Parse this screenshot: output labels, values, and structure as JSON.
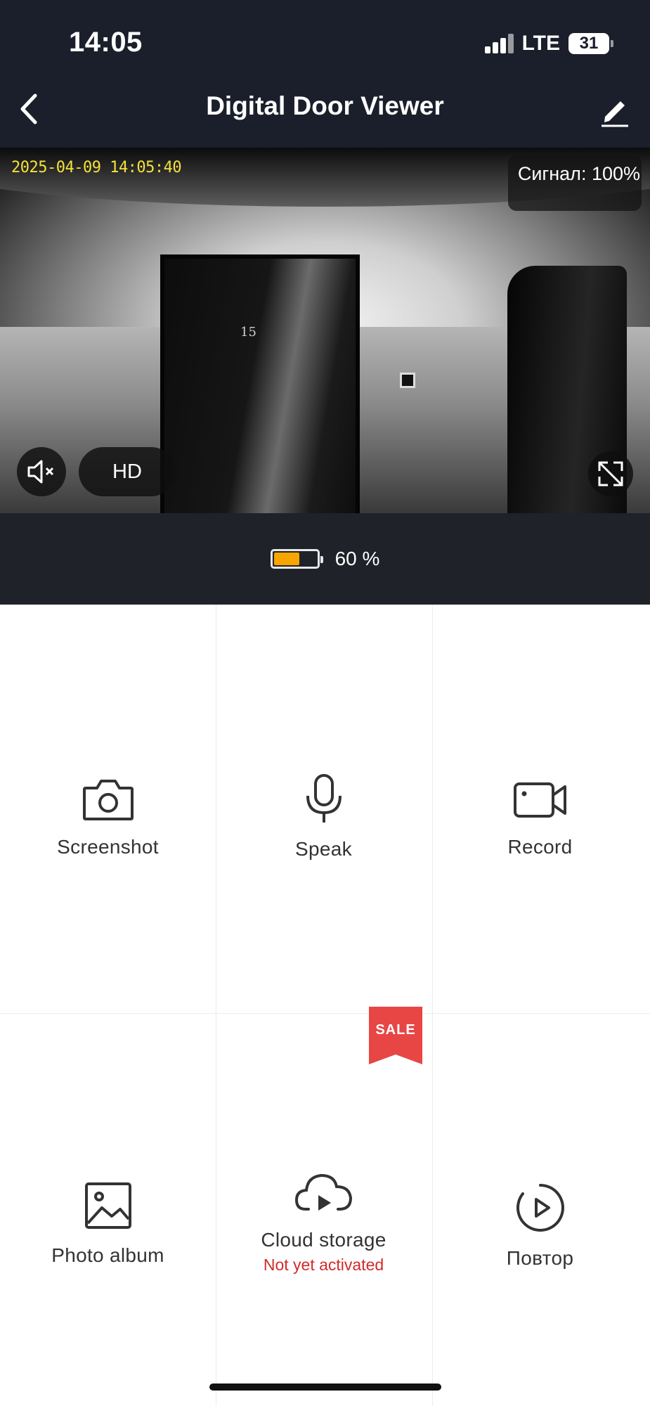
{
  "status_bar": {
    "time": "14:05",
    "network": "LTE",
    "battery": "31"
  },
  "header": {
    "title": "Digital Door Viewer",
    "back_icon": "chevron-left-icon",
    "edit_icon": "pencil-icon"
  },
  "video": {
    "timestamp": "2025-04-09 14:05:40",
    "signal_text": "Сигнал: 100%",
    "quality_label": "HD",
    "door_number": "15",
    "timestamp_color": "#f4e23a"
  },
  "battery": {
    "label": "60 %",
    "level_percent": 60,
    "fill_color": "#f7a500"
  },
  "actions": [
    {
      "label": "Screenshot",
      "icon": "camera-icon"
    },
    {
      "label": "Speak",
      "icon": "microphone-icon"
    },
    {
      "label": "Record",
      "icon": "video-camera-icon"
    },
    {
      "label": "Photo album",
      "icon": "image-icon"
    },
    {
      "label": "Cloud storage",
      "sublabel": "Not yet activated",
      "icon": "cloud-play-icon",
      "badge": "SALE"
    },
    {
      "label": "Повтор",
      "icon": "replay-icon"
    }
  ],
  "colors": {
    "header_bg": "#1b1f2b",
    "accent_red": "#d32a2a",
    "sale_badge": "#e84545"
  }
}
